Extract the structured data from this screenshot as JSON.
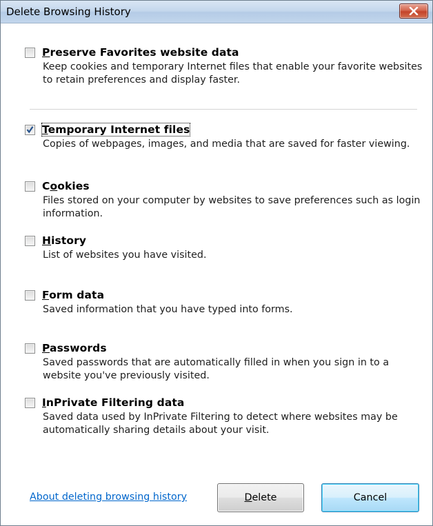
{
  "window": {
    "title": "Delete Browsing History"
  },
  "options": [
    {
      "mnemonic": "P",
      "rest": "reserve Favorites website data",
      "checked": false,
      "description": "Keep cookies and temporary Internet files that enable your favorite websites to retain preferences and display faster."
    },
    {
      "mnemonic": "T",
      "rest": "emporary Internet files",
      "checked": true,
      "description": "Copies of webpages, images, and media that are saved for faster viewing."
    },
    {
      "pre": "C",
      "mnemonic": "o",
      "rest": "okies",
      "checked": false,
      "description": "Files stored on your computer by websites to save preferences such as login information."
    },
    {
      "mnemonic": "H",
      "rest": "istory",
      "checked": false,
      "description": "List of websites you have visited."
    },
    {
      "mnemonic": "F",
      "rest": "orm data",
      "checked": false,
      "description": "Saved information that you have typed into forms."
    },
    {
      "mnemonic": "P",
      "rest": "asswords",
      "checked": false,
      "description": "Saved passwords that are automatically filled in when you sign in to a website you've previously visited."
    },
    {
      "mnemonic": "I",
      "rest": "nPrivate Filtering data",
      "checked": false,
      "description": "Saved data used by InPrivate Filtering to detect where websites may be automatically sharing details about your visit."
    }
  ],
  "footer": {
    "link_label": "About deleting browsing history",
    "delete_mnemonic": "D",
    "delete_rest": "elete",
    "cancel_label": "Cancel"
  }
}
